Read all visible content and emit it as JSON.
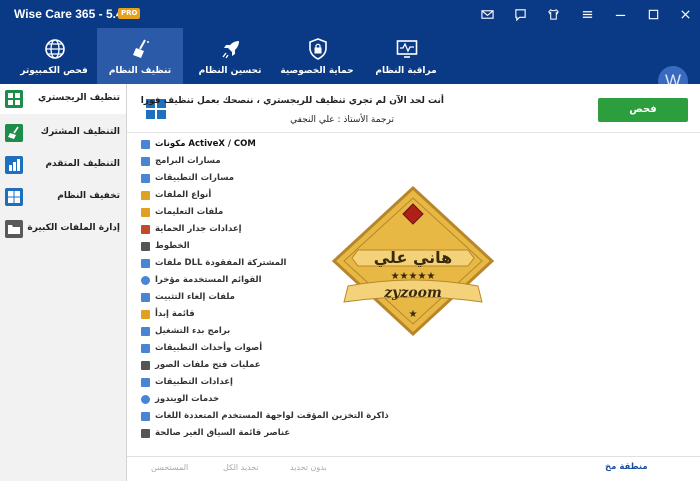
{
  "titlebar": {
    "app_title": "Wise Care 365 - 5.4.6",
    "badge": "PRO",
    "icons": [
      "mail-icon",
      "feedback-icon",
      "skin-icon",
      "menu-icon",
      "minimize-icon",
      "maximize-icon",
      "close-icon"
    ]
  },
  "nav": {
    "tabs": [
      {
        "label": "فحص الكمبيوتر",
        "icon": "globe-icon"
      },
      {
        "label": "تنظيف النظام",
        "icon": "broom-icon"
      },
      {
        "label": "تحسين النظام",
        "icon": "rocket-icon"
      },
      {
        "label": "حماية الخصوصية",
        "icon": "lock-shield-icon"
      },
      {
        "label": "مراقبة النظام",
        "icon": "monitor-pulse-icon"
      }
    ],
    "active_tab": "تنظيف النظام",
    "avatar_letter": "W"
  },
  "sidebar": {
    "items": [
      {
        "label": "تنظيف الريجستري",
        "icon": "windows-grid-icon"
      },
      {
        "label": "التنظيف المشترك",
        "icon": "broom-icon"
      },
      {
        "label": "التنظيف المتقدم",
        "icon": "advanced-clean-icon"
      },
      {
        "label": "تخفيف النظام",
        "icon": "windows-icon"
      },
      {
        "label": "إدارة الملفات الكبيرة",
        "icon": "folder-icon"
      }
    ],
    "active_item": "تنظيف الريجستري"
  },
  "banner": {
    "line1": "أنت لحد الآن لم تجري تنظيف للريجستري ، ننصحك بعمل تنظيف فورا",
    "line2": "ترجمة الأستاذ : علي النجفي",
    "scan_button": "فحص"
  },
  "registry_items": [
    {
      "label": "مكونات ActiveX / COM",
      "bold": true
    },
    {
      "label": "مسارات البرامج"
    },
    {
      "label": "مسارات التطبيقات"
    },
    {
      "label": "أنواع الملفات"
    },
    {
      "label": "ملفات التعليمات"
    },
    {
      "label": "إعدادات جدار الحماية"
    },
    {
      "label": "الخطوط"
    },
    {
      "label": "ملفات DLL المشتركة المفقودة"
    },
    {
      "label": "القوائم المستخدمة مؤخرا"
    },
    {
      "label": "ملفات إلغاء التثبيت"
    },
    {
      "label": "قائمة إبدأ"
    },
    {
      "label": "برامج بدء التشغيل"
    },
    {
      "label": "أصوات وأحداث التطبيقات"
    },
    {
      "label": "عمليات فتح ملفات الصور"
    },
    {
      "label": "إعدادات التطبيقات"
    },
    {
      "label": "خدمات الويندوز"
    },
    {
      "label": "ذاكرة التخزين المؤقت لواجهة المستخدم المتعددة اللغات"
    },
    {
      "label": "عناصر قائمة السياق الغير صالحة"
    }
  ],
  "stamp": {
    "name": "هاني علي",
    "stars": "★★★★★",
    "brand": "zyzoom",
    "star": "★"
  },
  "footer": {
    "recommended": "المستحسن",
    "select_all": "تحديد الكل",
    "select_none": "بدون تحديد",
    "safe_region": "منطقة مخ"
  },
  "colors": {
    "header": "#0a3a86",
    "active_tab": "#2a5aa8",
    "scan_button": "#2c9e3e",
    "sidebar_icon": "#1f8d4a",
    "stamp_gold": "#e8b845"
  }
}
